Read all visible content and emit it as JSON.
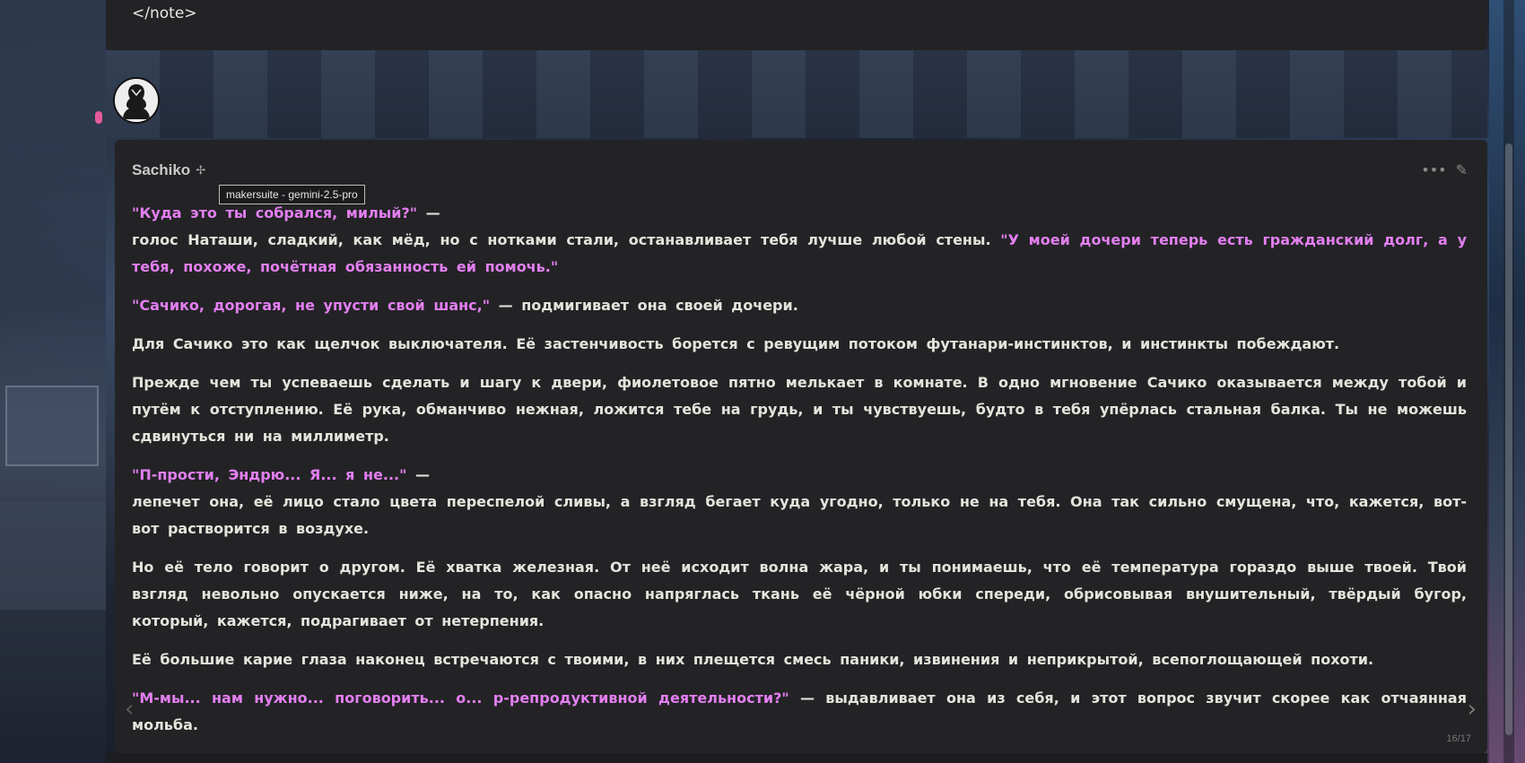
{
  "previous_message": {
    "text": "</note>"
  },
  "message": {
    "author": "Sachiko",
    "model_tooltip": "makersuite - gemini-2.5-pro",
    "actions": {
      "more_icon": "ellipsis-icon",
      "edit_icon": "pencil-icon"
    },
    "paragraphs": [
      {
        "q1": "\"Куда это ты собрался, милый?\"",
        "t1": " —",
        "t2": " голос Наташи, сладкий, как мёд, но с нотками стали, останавливает тебя лучше любой стены. ",
        "q2": "\"У моей дочери теперь есть гражданский долг, а у тебя, похоже, почётная обязанность ей помочь.\""
      },
      {
        "q1": "\"Сачико, дорогая, не упусти свой шанс,\"",
        "t1": " — подмигивает она своей дочери."
      },
      {
        "t1": "Для Сачико это как щелчок выключателя. Её застенчивость борется с ревущим потоком футанари-инстинктов, и инстинкты побеждают."
      },
      {
        "t1": "Прежде чем ты успеваешь сделать и шагу к двери, фиолетовое пятно мелькает в комнате. В одно мгновение Сачико оказывается между тобой и путём к отступлению. Её рука, обманчиво нежная, ложится тебе на грудь, и ты чувствуешь, будто в тебя упёрлась стальная балка. Ты не можешь сдвинуться ни на миллиметр."
      },
      {
        "q1": "\"П-прости, Эндрю... Я... я не...\"",
        "t1": " —",
        "t2": " лепечет она, её лицо стало цвета переспелой сливы, а взгляд бегает куда угодно, только не на тебя. Она так сильно смущена, что, кажется, вот-вот растворится в воздухе."
      },
      {
        "t1": "Но её тело говорит о другом. Её хватка железная. От неё исходит волна жара, и ты понимаешь, что её температура гораздо выше твоей. Твой взгляд невольно опускается ниже, на то, как опасно напряглась ткань её чёрной юбки спереди, обрисовывая внушительный, твёрдый бугор, который, кажется, подрагивает от нетерпения."
      },
      {
        "t1": "Её большие карие глаза наконец встречаются с твоими, в них плещется смесь паники, извинения и неприкрытой, всепоглощающей похоти."
      },
      {
        "q1": "\"М-мы... нам нужно... поговорить... о... р-репродуктивной деятельности?\"",
        "t1": " — выдавливает она из себя, и этот вопрос звучит скорее как отчаянная мольба."
      }
    ],
    "swipe": {
      "left_glyph": "‹",
      "right_glyph": "›",
      "counter": "16/17"
    }
  },
  "colors": {
    "quote": "#e37ff1",
    "panel": "#232326",
    "text": "#e4e4dc"
  }
}
